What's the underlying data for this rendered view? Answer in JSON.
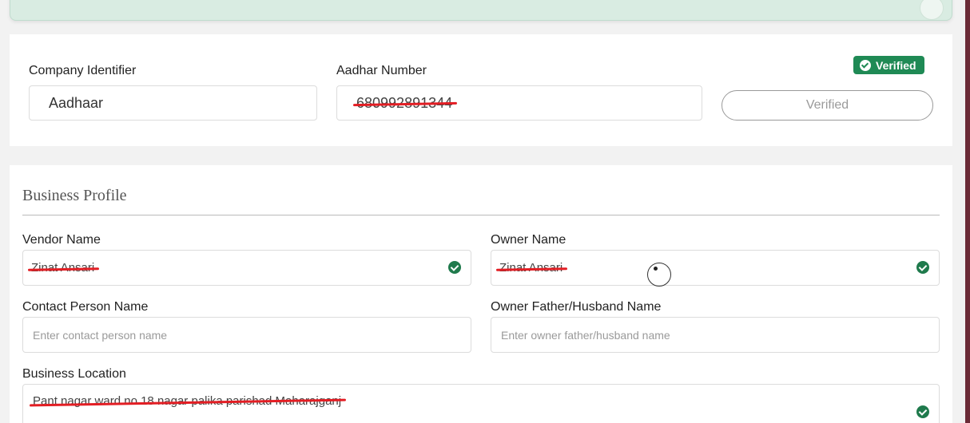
{
  "aadhar_section": {
    "company_identifier_label": "Company Identifier",
    "company_identifier_value": "Aadhaar",
    "aadhar_number_label": "Aadhar Number",
    "aadhar_number_value": "680992891344",
    "verified_badge": "Verified",
    "verified_button": "Verified"
  },
  "business_profile": {
    "title": "Business Profile",
    "vendor_name_label": "Vendor Name",
    "vendor_name_value": "Zinat Ansari",
    "owner_name_label": "Owner Name",
    "owner_name_value": "Zinat Ansari",
    "contact_person_label": "Contact Person Name",
    "contact_person_placeholder": "Enter contact person name",
    "owner_father_label": "Owner Father/Husband Name",
    "owner_father_placeholder": "Enter owner father/husband name",
    "business_location_label": "Business Location",
    "business_location_value": "Pant nagar ward no 18 nagar palika parishad Maharajganj"
  },
  "colors": {
    "accent_green": "#1f8a55",
    "redaction_red": "#e31e24",
    "scrollbar": "#6b2a37"
  }
}
